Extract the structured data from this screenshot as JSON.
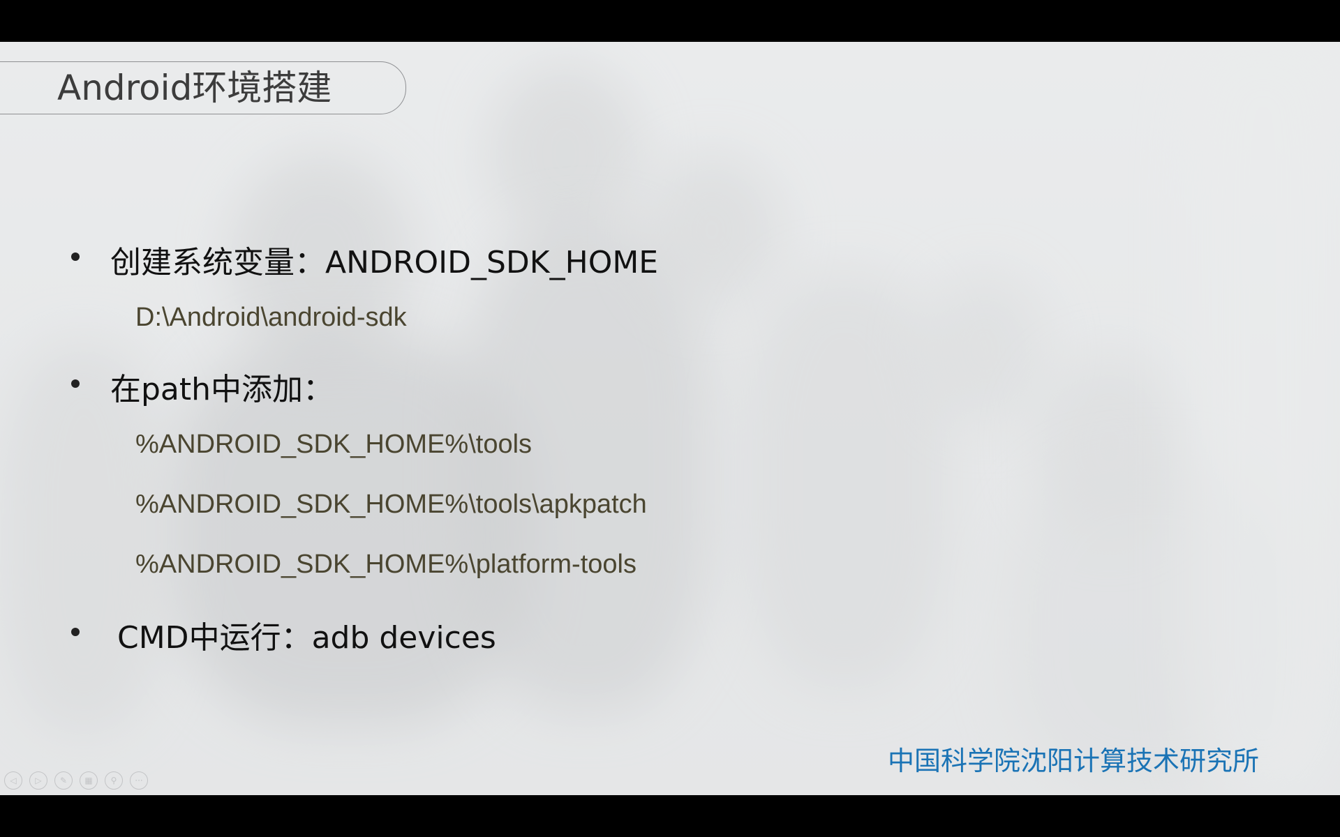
{
  "slide": {
    "title": "Android环境搭建",
    "bullets": [
      {
        "label": "创建系统变量：ANDROID_SDK_HOME"
      },
      {
        "label": "在path中添加："
      },
      {
        "label": "CMD中运行：adb devices"
      }
    ],
    "sub_items": [
      "D:\\Android\\android-sdk",
      "%ANDROID_SDK_HOME%\\tools",
      "%ANDROID_SDK_HOME%\\tools\\apkpatch",
      "%ANDROID_SDK_HOME%\\platform-tools"
    ],
    "organization": "中国科学院沈阳计算技术研究所"
  },
  "nav_controls": [
    {
      "name": "previous-slide",
      "icon": "arrow-left-icon",
      "glyph": "◁"
    },
    {
      "name": "next-slide",
      "icon": "arrow-right-icon",
      "glyph": "▷"
    },
    {
      "name": "pen-tool",
      "icon": "pen-icon",
      "glyph": "✎"
    },
    {
      "name": "see-all-slides",
      "icon": "grid-icon",
      "glyph": "▦"
    },
    {
      "name": "zoom",
      "icon": "magnifier-icon",
      "glyph": "⚲"
    },
    {
      "name": "more-options",
      "icon": "more-icon",
      "glyph": "···"
    }
  ],
  "colors": {
    "title_text": "#3c3c3c",
    "bullet_text": "#111111",
    "sub_text": "#4a4530",
    "organization_text": "#1a73b5",
    "letterbox": "#000000"
  }
}
